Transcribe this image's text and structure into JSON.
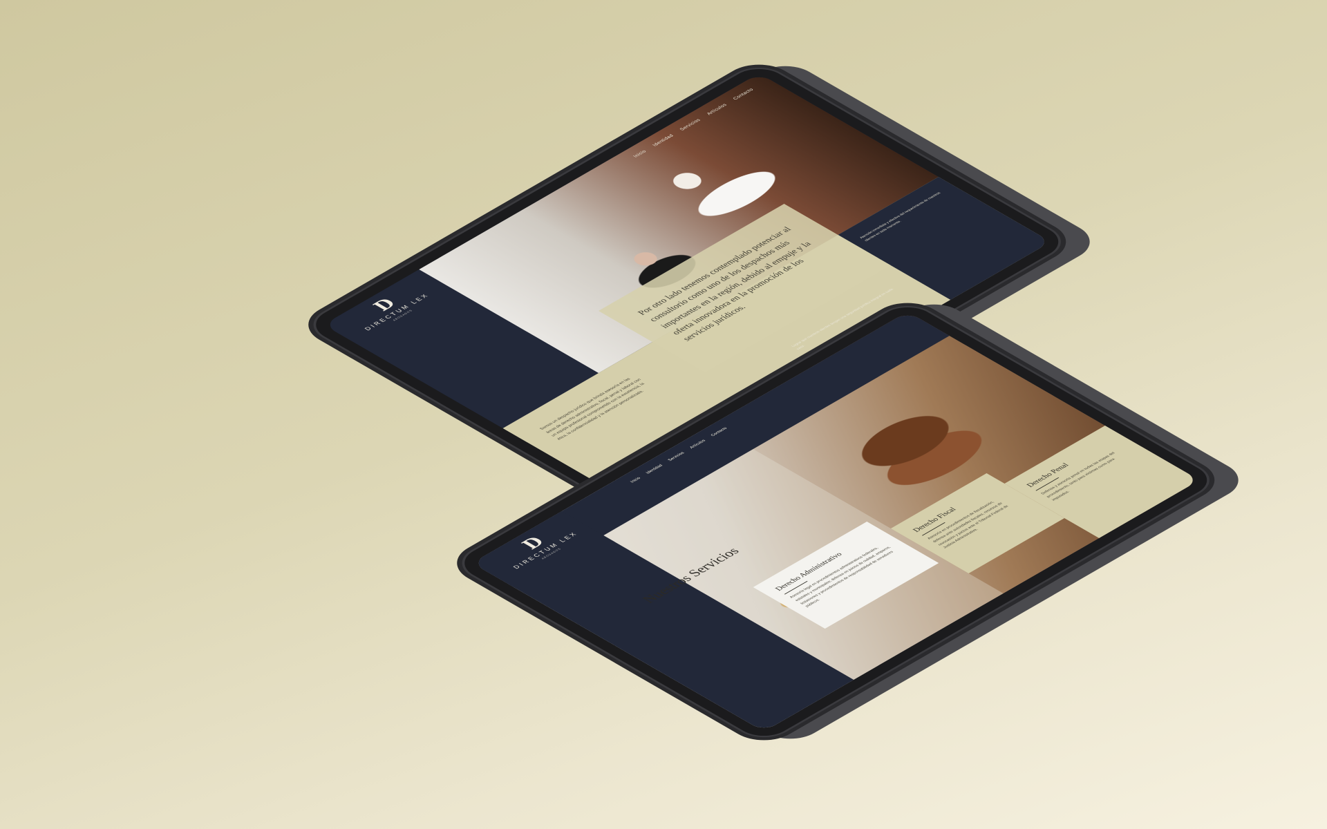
{
  "tablet_home": {
    "logo": {
      "mark": "D",
      "brand": "DIRECTUM LEX",
      "sub": "ABOGADOS"
    },
    "nav": [
      "Inicio",
      "Identidad",
      "Servicios",
      "Artículos",
      "Contacto"
    ],
    "hero_text": "Por otro lado tenemos contemplado potenciar al consultorio como uno de los despachos más importantes en la región, debido al empuje y la oferta innovadora en la promoción de los servicios jurídicos.",
    "left_text": "Somos un despacho jurídico que brinda asesoría en las áreas de derecho administrativo, fiscal, penal y laboral con un equipo profesional comprometido con la excelencia, la ética, la confidencialidad y la atención personalizada.",
    "dark_text": "Atención inmediata y efectiva del requerimiento de nuestros clientes en todo momento.",
    "caption": "Lograr que nuestros clientes tengan una seguridad jurídica integral en cada caso."
  },
  "tablet_services": {
    "nav": [
      "Inicio",
      "Identidad",
      "Servicios",
      "Artículos",
      "Contacto"
    ],
    "title": "Nuestros Servicios",
    "cards": [
      {
        "title": "Derecho Administrativo",
        "text": "Asesoría legal en procedimientos administrativos federales, estatales y municipales; defensa en juicios de nulidad, amparos, licitaciones y procedimientos de responsabilidad de servidores públicos."
      },
      {
        "title": "Derecho Fiscal",
        "text": "Asesoría en procedimientos de fiscalización, defensa ante autoridades fiscales, recursos de revocación y juicios ante el Tribunal Federal de Justicia Administrativa."
      },
      {
        "title": "Derecho Penal",
        "text": "Defensa y asesoría penal en todas las etapas del procedimiento, tanto para víctimas como para imputados."
      }
    ]
  }
}
